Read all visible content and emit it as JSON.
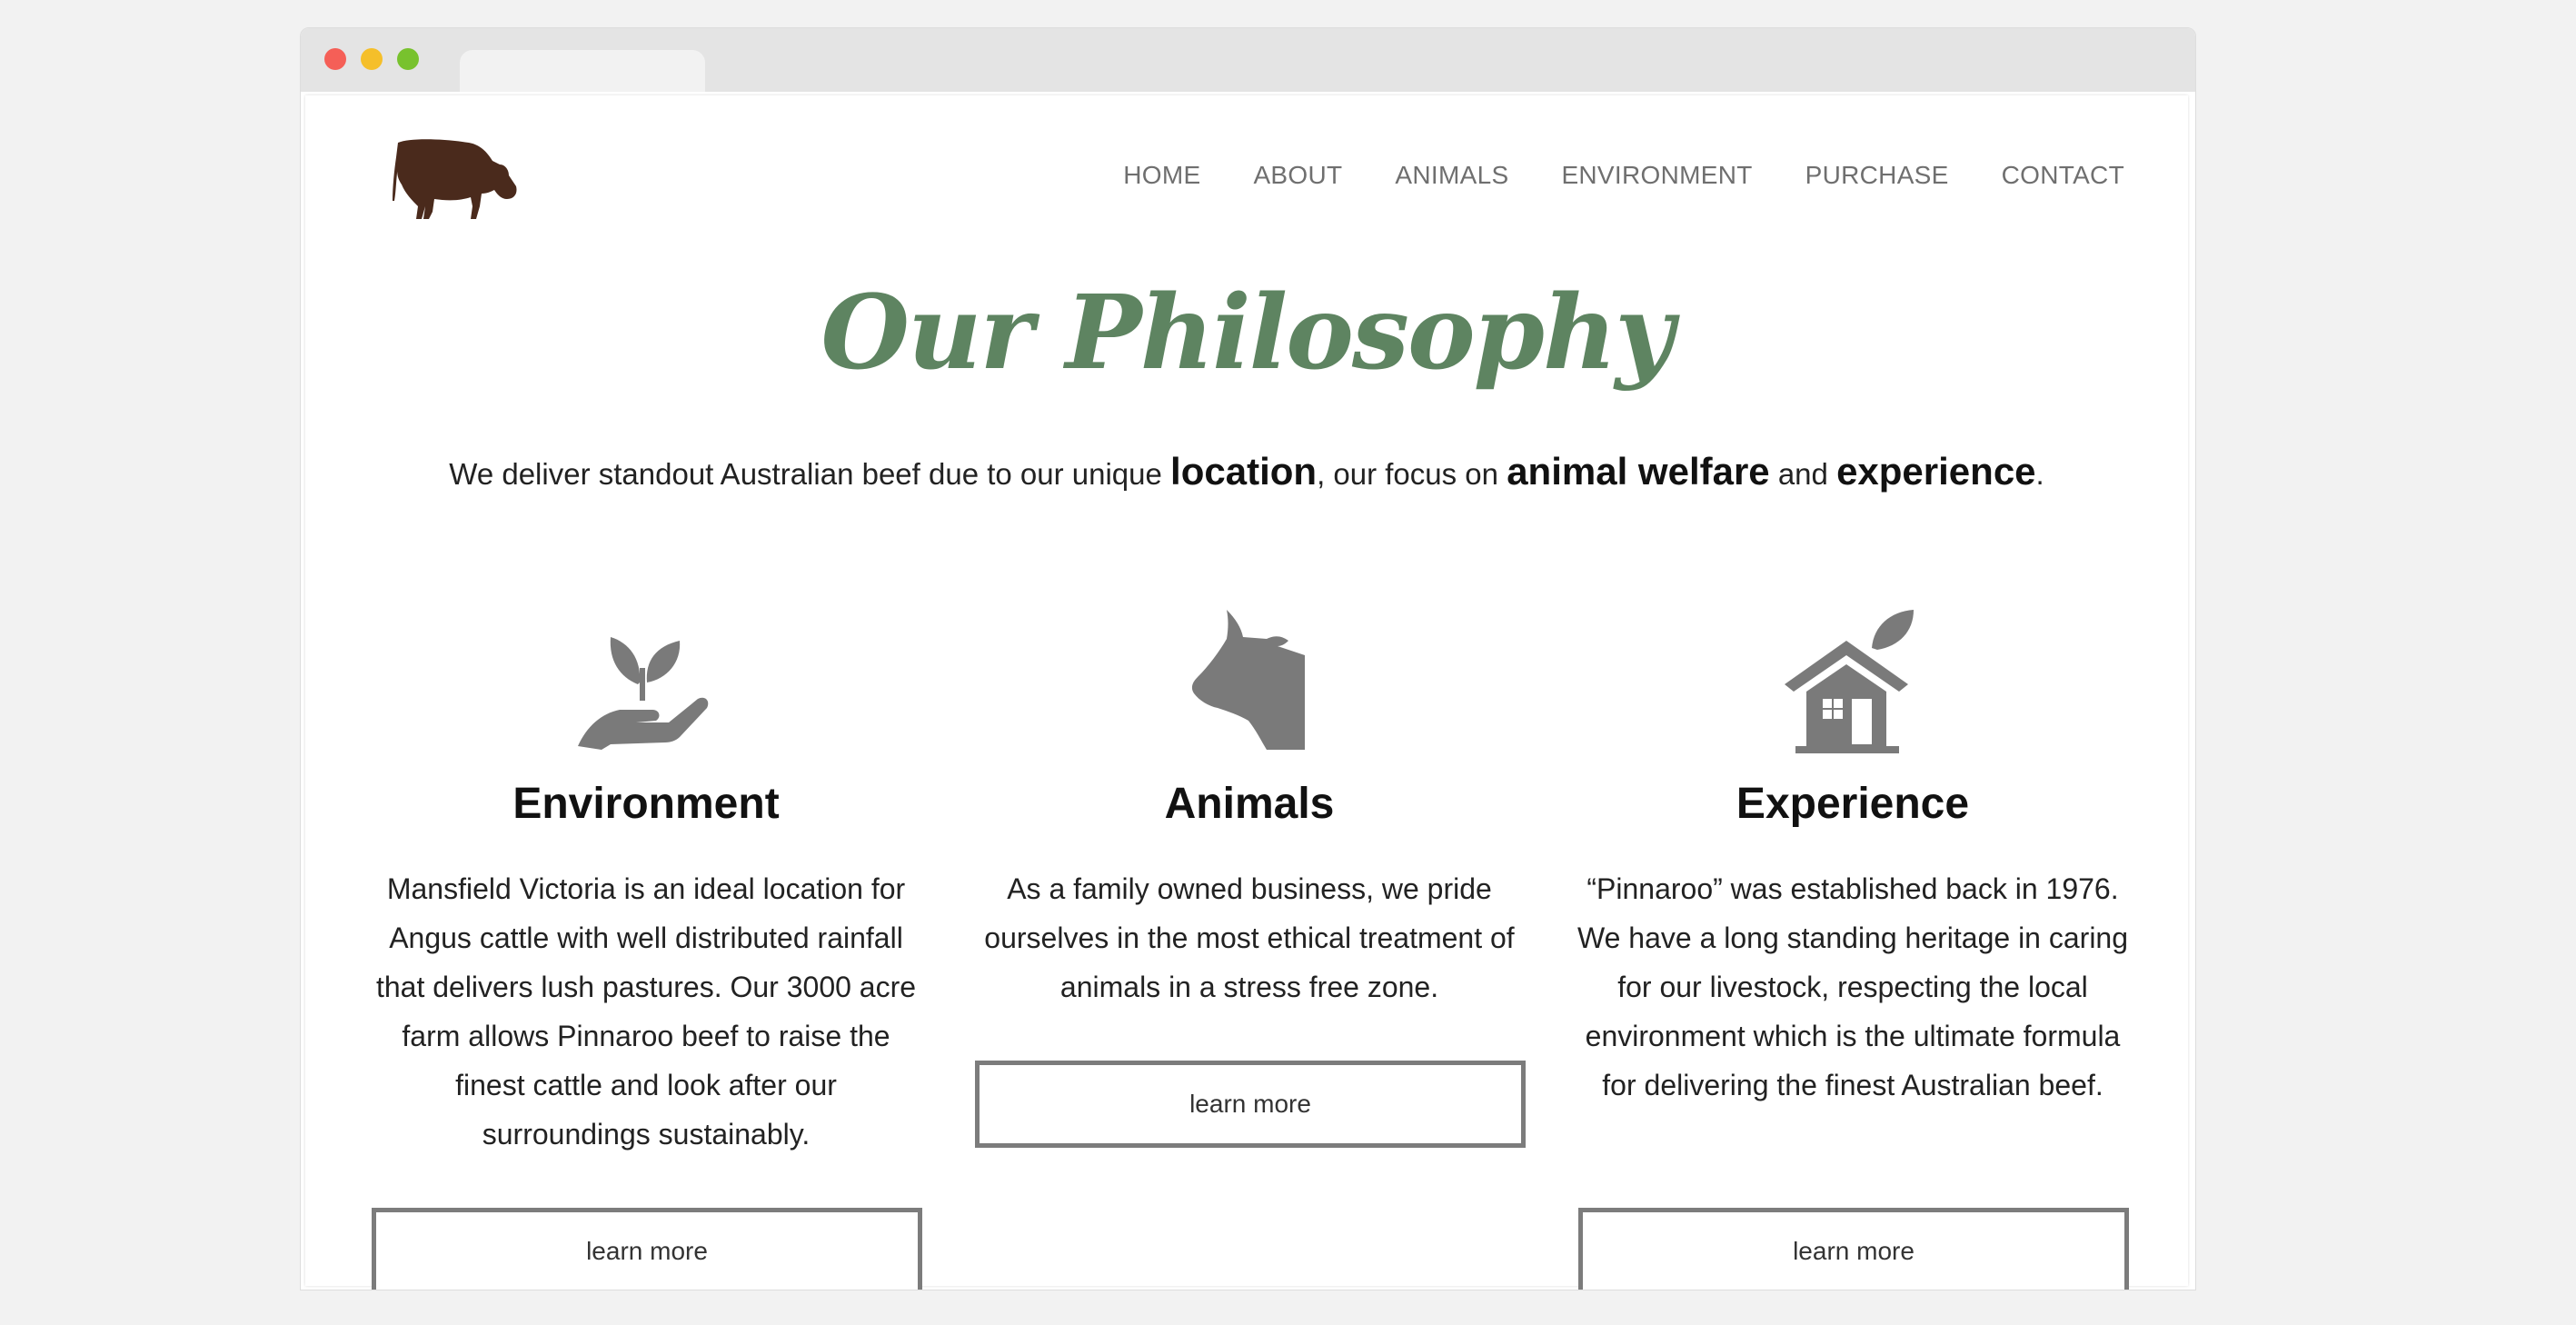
{
  "nav": {
    "items": [
      "HOME",
      "ABOUT",
      "ANIMALS",
      "ENVIRONMENT",
      "PURCHASE",
      "CONTACT"
    ]
  },
  "hero": {
    "title": "Our Philosophy",
    "intro_part1": "We deliver standout Australian beef due to our unique ",
    "intro_location": "location",
    "intro_part2": ", our focus on ",
    "intro_welfare": "animal welfare",
    "intro_part3": " and ",
    "intro_experience": "experience",
    "intro_part4": "."
  },
  "columns": [
    {
      "icon": "plant-in-hand-icon",
      "heading": "Environment",
      "text": "Mansfield Victoria is an ideal location for Angus cattle with well distributed rainfall that delivers lush pastures. Our 3000 acre farm allows Pinnaroo beef to raise the finest cattle and look after our surroundings sustainably.",
      "button": "learn more"
    },
    {
      "icon": "cow-head-icon",
      "heading": "Animals",
      "text": "As a family owned business, we pride ourselves in the most ethical treatment of animals in a stress free zone.",
      "button": "learn more"
    },
    {
      "icon": "house-leaf-icon",
      "heading": "Experience",
      "text": "“Pinnaroo” was established back in 1976. We have a long standing heritage in caring for our livestock, respecting the local environment which is the ultimate formula for delivering the finest Australian beef.",
      "button": "learn more"
    }
  ],
  "colors": {
    "title": "#5e8461",
    "icon": "#7a7a7a",
    "logo": "#4a2a1c",
    "nav": "#6f6f6f"
  }
}
